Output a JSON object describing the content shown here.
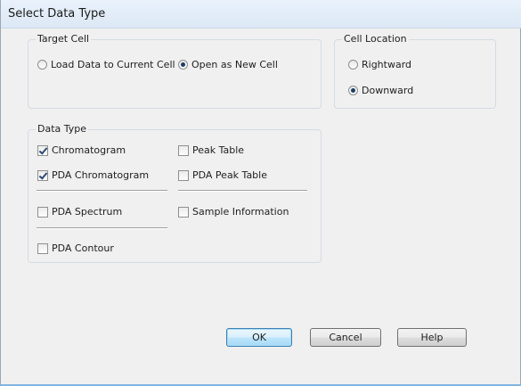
{
  "window": {
    "title": "Select Data Type"
  },
  "target_cell": {
    "label": "Target Cell",
    "options": [
      {
        "label": "Load Data to Current Cell",
        "selected": false
      },
      {
        "label": "Open as New Cell",
        "selected": true
      }
    ]
  },
  "cell_location": {
    "label": "Cell Location",
    "options": [
      {
        "label": "Rightward",
        "selected": false
      },
      {
        "label": "Downward",
        "selected": true
      }
    ]
  },
  "data_type": {
    "label": "Data Type",
    "items": {
      "chromatogram": {
        "label": "Chromatogram",
        "checked": true
      },
      "peak_table": {
        "label": "Peak Table",
        "checked": false
      },
      "pda_chromatogram": {
        "label": "PDA Chromatogram",
        "checked": true
      },
      "pda_peak_table": {
        "label": "PDA Peak Table",
        "checked": false
      },
      "pda_spectrum": {
        "label": "PDA Spectrum",
        "checked": false
      },
      "sample_information": {
        "label": "Sample Information",
        "checked": false
      },
      "pda_contour": {
        "label": "PDA Contour",
        "checked": false
      }
    }
  },
  "buttons": {
    "ok": "OK",
    "cancel": "Cancel",
    "help": "Help"
  },
  "colors": {
    "default_button_border": "#3c7fb1",
    "bottom_accent": "#7fb6e3"
  }
}
